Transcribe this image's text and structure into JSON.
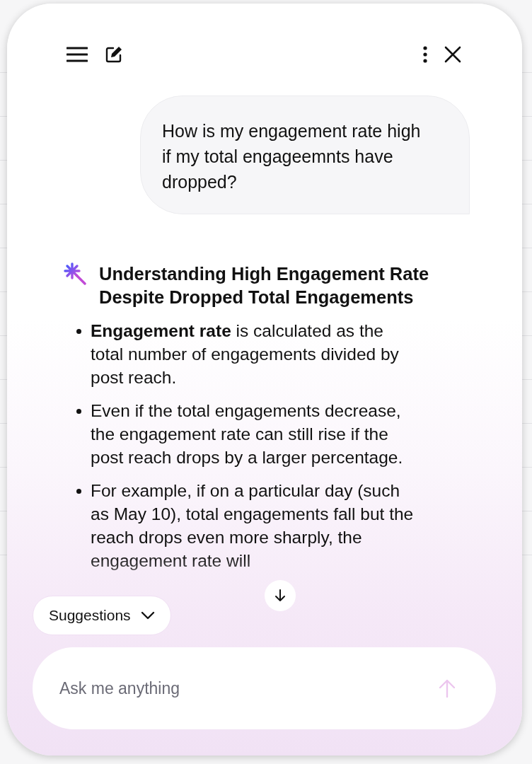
{
  "user_message": "How is my engagement rate high if my total engageemnts have dropped?",
  "answer": {
    "title": "Understanding High Engagement Rate Despite Dropped Total Engagements",
    "bullets": [
      "**Engagement rate** is calculated as the total number of engagements divided by post reach.",
      "Even if the total engagements decrease, the engagement rate can still rise if the post reach drops by a larger percentage.",
      "For example, if on a particular day (such as May 10), total engagements fall but the reach drops even more sharply, the engagement rate will"
    ]
  },
  "suggestions": {
    "label": "Suggestions",
    "expanded": false
  },
  "input": {
    "placeholder": "Ask me anything",
    "send_disabled": true
  }
}
